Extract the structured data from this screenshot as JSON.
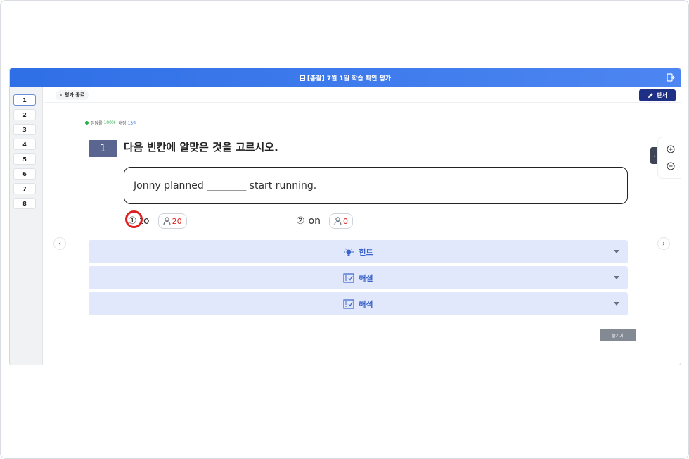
{
  "window": {
    "title": "[총괄] 7월 1일 학습 확인 평가",
    "exit_icon": "exit-icon"
  },
  "sidebar": {
    "items": [
      {
        "label": "1",
        "active": true
      },
      {
        "label": "2"
      },
      {
        "label": "3"
      },
      {
        "label": "4"
      },
      {
        "label": "5"
      },
      {
        "label": "6"
      },
      {
        "label": "7"
      },
      {
        "label": "8"
      }
    ]
  },
  "toolbar": {
    "end_label": "평가 종료",
    "board_label": "판서",
    "board_icon": "pencil-icon"
  },
  "stats": {
    "rate_label": "정답률",
    "rate_value": "100%",
    "score_label": "배점",
    "score_value": "13점"
  },
  "question": {
    "number": "1",
    "text": "다음 빈칸에 알맞은 것을 고르시오.",
    "passage": "Jonny planned ________ start running."
  },
  "choices": [
    {
      "num": "①",
      "text": "to",
      "count": "20",
      "selected": true
    },
    {
      "num": "②",
      "text": "on",
      "count": "0",
      "selected": false
    }
  ],
  "panels": [
    {
      "label": "힌트",
      "icon": "lightbulb-icon"
    },
    {
      "label": "해설",
      "icon": "checklist-icon"
    },
    {
      "label": "해석",
      "icon": "checklist-icon"
    }
  ],
  "hide_label": "숨기기",
  "colors": {
    "header": "#2f6fe6",
    "board_btn": "#1e2f86",
    "panel_bg": "#e1e8fb",
    "panel_text": "#3a63c9",
    "count_red": "#e02424",
    "mark_red": "#e01e1e"
  }
}
